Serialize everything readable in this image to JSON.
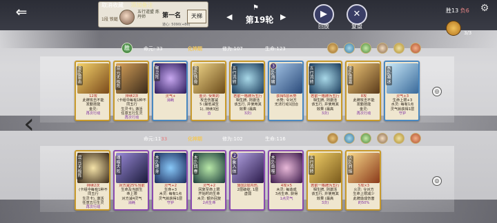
{
  "header": {
    "back_icon": "back-arrow-icon",
    "rank_card": {
      "tab_cancel": "取消收藏",
      "tab_add": "添加备注",
      "tier": "1段 铁鎚",
      "title": "五行道盟 炼丹师",
      "place": "第一名",
      "sub": "道心: 5090(+86)",
      "ladder": "天梯"
    },
    "round": "第19轮",
    "replay_label": "回放",
    "review_label": "复盘",
    "score": {
      "win_label": "胜",
      "win": "13",
      "lose_label": "负",
      "lose": "6"
    },
    "coin_count": "3/3"
  },
  "opponent": {
    "avatar_label": "胜",
    "life_label": "命元:",
    "life": "33",
    "realm": "化神期",
    "cultivation_label": "修为:",
    "cultivation": "107",
    "hp_label": "生命:",
    "hp": "123",
    "cards": [
      {
        "name": "金灵·雷击",
        "level": "",
        "desc_main": "12攻",
        "desc_a": "此牌攻击不能",
        "desc_b": "发動技能",
        "desc_c": "金灵: ",
        "desc_hl": "再次行动"
      },
      {
        "name": "混元无极阵",
        "level": "",
        "desc_main": "持续2次",
        "desc_a": "(卡组中每有1种不同五行",
        "desc_b": "生灵卡), 激活",
        "desc_c": "任意五行生灵",
        "desc_hl": "再次行动"
      },
      {
        "name": "聚灵阵",
        "level": "",
        "desc_main": "灵气+",
        "desc_a": "",
        "desc_b": "",
        "desc_c": "",
        "desc_hl": "消耗"
      },
      {
        "name": "金灵·铁骨",
        "level": "",
        "desc_main": "金灵: 受到的",
        "desc_a": "攻击伤害减",
        "desc_b": "5 (最低减至",
        "desc_c": "1), 持续3回",
        "desc_hl": "合"
      },
      {
        "name": "五行流转",
        "level": "",
        "desc_main": "若前一格牌为五行",
        "desc_a": "相生牌, 则激活",
        "desc_b": "该五行, 并使用其",
        "desc_c": "效果 (最高",
        "desc_hl": "3次)"
      },
      {
        "name": "水灵·海啸",
        "level": "3",
        "desc_main": "获得5层水势",
        "desc_a": "水势: 令对方",
        "desc_b": "无法行动1回合",
        "desc_c": "",
        "desc_hl": ""
      },
      {
        "name": "五行流转",
        "level": "",
        "desc_main": "若前一格牌为五行",
        "desc_a": "相生牌, 则激活",
        "desc_b": "该五行, 并使用其",
        "desc_c": "效果 (最高",
        "desc_hl": "3次)"
      },
      {
        "name": "金灵·雷霆",
        "level": "",
        "desc_main": "8攻",
        "desc_a": "此牌攻击不能",
        "desc_b": "发動技能",
        "desc_c": "金灵: ",
        "desc_hl": "再次行动"
      },
      {
        "name": "水灵·凝冰",
        "level": "",
        "desc_main": "灵气+3",
        "desc_a": "生命上限+3",
        "desc_b": "水灵: 每有1点",
        "desc_c": "灵气就获得1层",
        "desc_hl": "守护"
      }
    ],
    "buff_icons": [
      "buff-fire-icon",
      "buff-water-icon",
      "buff-wood-icon",
      "buff-earth-icon",
      "buff-metal-icon",
      "buff-seal-icon"
    ]
  },
  "player": {
    "life_label": "命元:",
    "life": "11",
    "life_extra": "33",
    "realm": "化神期",
    "cultivation_label": "修为:",
    "cultivation": "102",
    "hp_label": "生命:",
    "hp": "116",
    "cards": [
      {
        "name": "混元无极阵",
        "level": "",
        "desc_main": "持续2次",
        "desc_a": "(卡组中每有1种不同五行",
        "desc_b": "生灵卡), 激活",
        "desc_c": "任意五行生灵",
        "desc_hl": "再次行动"
      },
      {
        "name": "魂噬大阵",
        "level": "",
        "desc_main": "对方减25%当前",
        "desc_a": "生命及当前生",
        "desc_b": "命上限",
        "desc_c": "对方减4灵气",
        "desc_hl": "消耗"
      },
      {
        "name": "木灵·缠身",
        "level": "",
        "desc_main": "灵气+2",
        "desc_a": "生命+3",
        "desc_b": "木灵: 每有1点",
        "desc_c": "灵气就获得1层",
        "desc_hl": "守护"
      },
      {
        "name": "木灵·回春",
        "level": "",
        "desc_main": "灵气+2",
        "desc_a": "回复至命上限",
        "desc_b": "开始时的生命",
        "desc_c": "木灵: 额外回复",
        "desc_hl": "2点生命"
      },
      {
        "name": "万象入体",
        "level": "2",
        "desc_main": "施加2层内伤,",
        "desc_a": "2层破绽, 1层",
        "desc_b": "虚弱",
        "desc_c": "",
        "desc_hl": ""
      },
      {
        "name": "木灵·吞噬",
        "level": "",
        "desc_main": "4攻×5",
        "desc_a": "木灵: 每造成",
        "desc_b": "3点生命, 获得",
        "desc_c": "",
        "desc_hl": "1点灵气"
      },
      {
        "name": "五行流转",
        "level": "",
        "desc_main": "若前一格牌为五行",
        "desc_a": "相生牌, 则激活",
        "desc_b": "该五行, 并使用其",
        "desc_c": "效果 (最高",
        "desc_hl": "3次)"
      },
      {
        "name": "火灵·烈焰",
        "level": "",
        "desc_main": "5攻×3",
        "desc_a": "火灵: 令对方",
        "desc_b": "生命上限减少",
        "desc_c": "此牌造成伤害",
        "desc_hl": "的50%"
      }
    ],
    "buff_icons": [
      "buff-fire-icon",
      "buff-water-icon",
      "buff-wood-icon",
      "buff-earth-icon",
      "buff-metal-icon",
      "buff-seal-icon"
    ]
  }
}
